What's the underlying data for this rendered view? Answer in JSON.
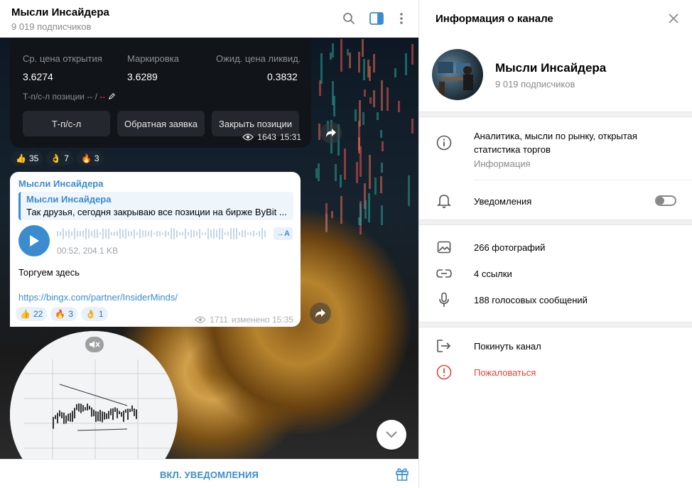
{
  "chat": {
    "title": "Мысли Инсайдера",
    "subtitle": "9 019 подписчиков",
    "trade_card": {
      "labels": [
        "Ср. цена открытия",
        "Маркировка",
        "Ожид. цена ликвид."
      ],
      "values": [
        "3.6274",
        "3.6289",
        "0.3832"
      ],
      "tpsl_label": "Т-п/с-л позиции -- /",
      "tpsl_dash": "--",
      "buttons": [
        "Т-п/с-л",
        "Обратная заявка",
        "Закрыть позиции"
      ],
      "views": "1643",
      "time": "15:31"
    },
    "reactions_1": [
      {
        "emoji": "👍",
        "count": "35"
      },
      {
        "emoji": "👌",
        "count": "7"
      },
      {
        "emoji": "🔥",
        "count": "3"
      }
    ],
    "message": {
      "author": "Мысли Инсайдера",
      "quote_author": "Мысли Инсайдера",
      "quote_text": "Так друзья, сегодня закрываю все позиции на бирже ByBit ...",
      "transcribe_label": "→A",
      "voice_meta": "00:52, 204.1 KB",
      "text": "Торгуем здесь",
      "link": "https://bingx.com/partner/InsiderMinds/",
      "views": "1711",
      "edited": "изменено 15:35"
    },
    "reactions_2": [
      {
        "emoji": "👍",
        "count": "22"
      },
      {
        "emoji": "🔥",
        "count": "3"
      },
      {
        "emoji": "👌",
        "count": "1"
      }
    ],
    "footer_button": "ВКЛ. УВЕДОМЛЕНИЯ"
  },
  "panel": {
    "title": "Информация о канале",
    "name": "Мысли Инсайдера",
    "subscribers": "9 019 подписчиков",
    "description": "Аналитика, мысли по рынку, открытая статистика торгов",
    "description_label": "Информация",
    "notifications_label": "Уведомления",
    "notifications_on": false,
    "media": {
      "photos": "266 фотографий",
      "links": "4 ссылки",
      "voice": "188 голосовых сообщений"
    },
    "leave": "Покинуть канал",
    "report": "Пожаловаться"
  },
  "colors": {
    "accent": "#3a8ccf",
    "danger": "#e0453c"
  }
}
